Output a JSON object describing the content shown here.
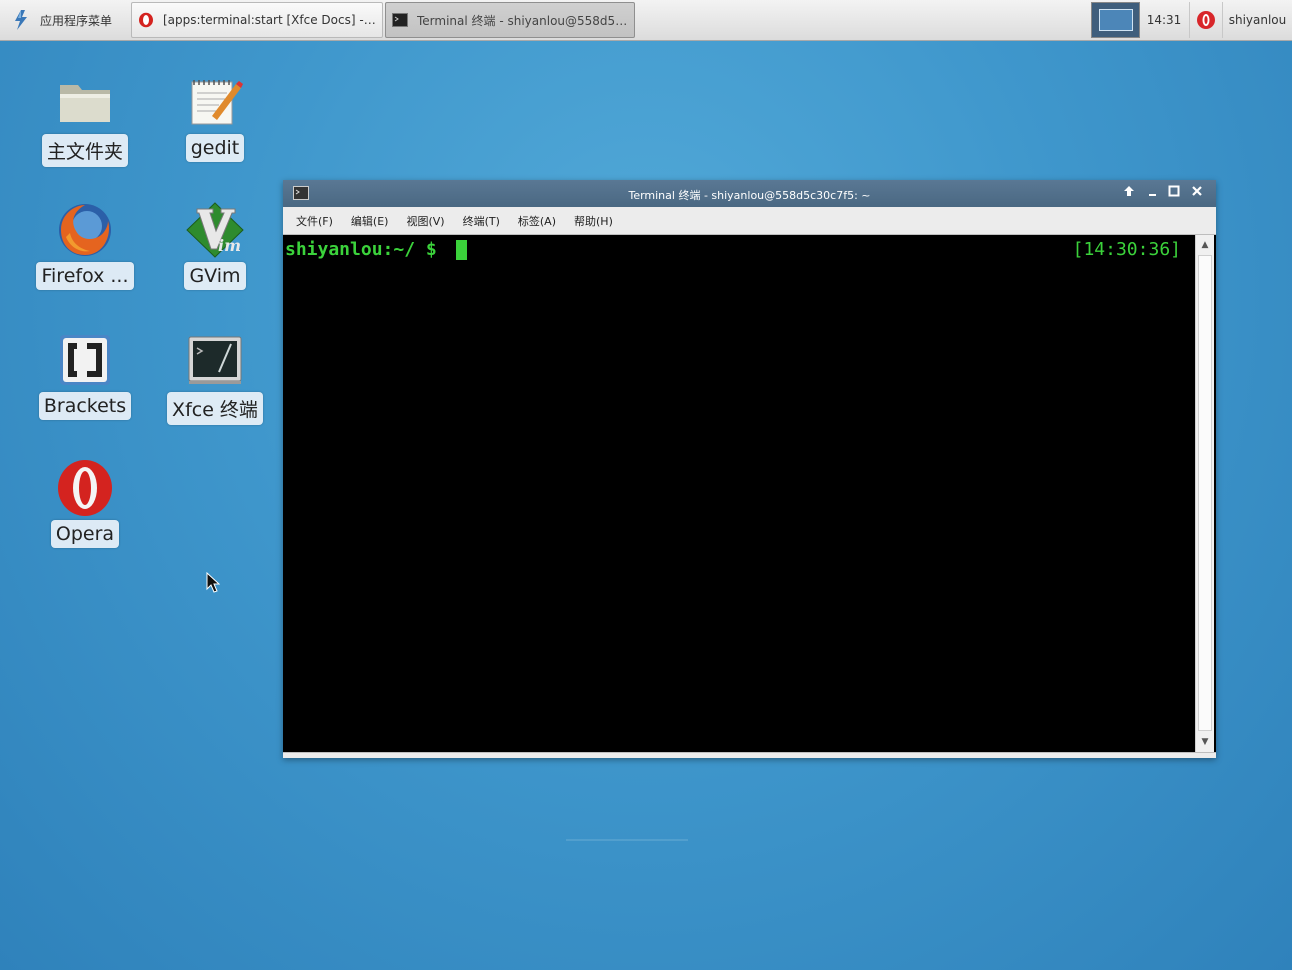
{
  "panel": {
    "menu_label": "应用程序菜单",
    "tasks": [
      {
        "label": "[apps:terminal:start [Xfce Docs] - Op...",
        "icon": "opera-icon",
        "active": false
      },
      {
        "label": "Terminal 终端 - shiyanlou@558d5c...",
        "icon": "terminal-icon",
        "active": true
      }
    ],
    "clock": "14:31",
    "user": "shiyanlou"
  },
  "desktop": {
    "icons": [
      {
        "label": "主文件夹",
        "icon": "folder-icon"
      },
      {
        "label": "gedit",
        "icon": "gedit-icon"
      },
      {
        "label": "Firefox ...",
        "icon": "firefox-icon"
      },
      {
        "label": "GVim",
        "icon": "gvim-icon"
      },
      {
        "label": "Brackets",
        "icon": "brackets-icon"
      },
      {
        "label": "Xfce 终端",
        "icon": "xfce-terminal-icon"
      },
      {
        "label": "Opera",
        "icon": "opera-icon"
      }
    ]
  },
  "window": {
    "title": "Terminal 终端 - shiyanlou@558d5c30c7f5: ~",
    "menu": [
      "文件(F)",
      "编辑(E)",
      "视图(V)",
      "终端(T)",
      "标签(A)",
      "帮助(H)"
    ],
    "prompt": "shiyanlou:~/ $ ",
    "right_time": "[14:30:36]"
  },
  "colors": {
    "prompt": "#3bd23b",
    "titlebar": "#4f6d88",
    "desktop": "#3f97cc"
  }
}
